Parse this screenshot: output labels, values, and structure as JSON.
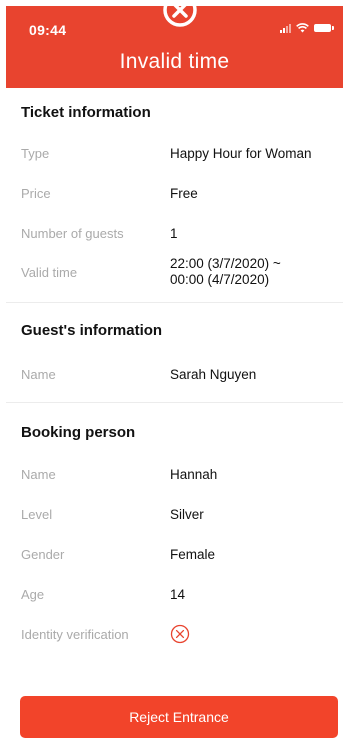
{
  "status_bar": {
    "time": "09:44"
  },
  "header": {
    "title": "Invalid time"
  },
  "ticket_info": {
    "title": "Ticket information",
    "rows": [
      {
        "label": "Type",
        "value": "Happy Hour for Woman"
      },
      {
        "label": "Price",
        "value": "Free"
      },
      {
        "label": "Number of guests",
        "value": "1"
      },
      {
        "label": "Valid time",
        "value_line1": "22:00 (3/7/2020) ~",
        "value_line2": "00:00 (4/7/2020)"
      }
    ]
  },
  "guest_info": {
    "title": "Guest's information",
    "rows": [
      {
        "label": "Name",
        "value": "Sarah Nguyen"
      }
    ]
  },
  "booking_person": {
    "title": "Booking person",
    "rows": [
      {
        "label": "Name",
        "value": "Hannah"
      },
      {
        "label": "Level",
        "value": "Silver"
      },
      {
        "label": "Gender",
        "value": "Female"
      },
      {
        "label": "Age",
        "value": "14"
      },
      {
        "label": "Identity verification",
        "icon": "x-circle-icon",
        "icon_color": "#e8442f"
      }
    ]
  },
  "actions": {
    "reject_label": "Reject Entrance"
  },
  "colors": {
    "accent": "#e8442f",
    "label_gray": "#aaaaaa"
  }
}
